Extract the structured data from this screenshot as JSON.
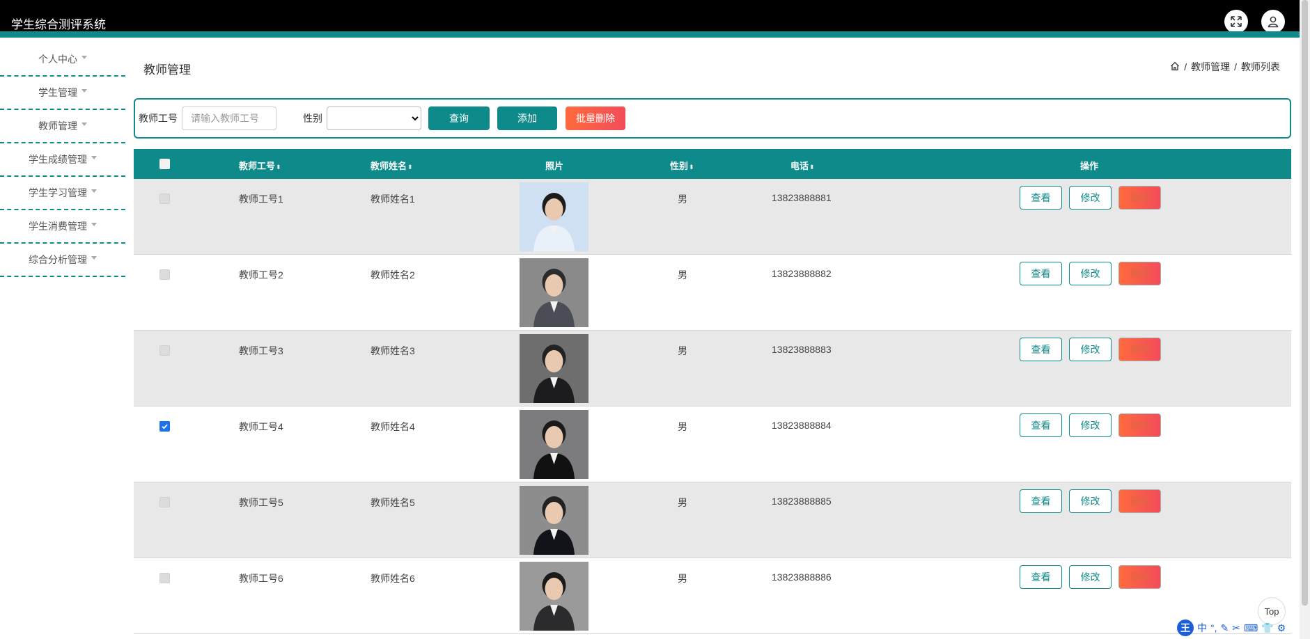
{
  "app": {
    "title": "学生综合测评系统"
  },
  "header_icons": [
    "fullscreen-icon",
    "user-icon"
  ],
  "sidebar": {
    "items": [
      {
        "label": "个人中心"
      },
      {
        "label": "学生管理"
      },
      {
        "label": "教师管理"
      },
      {
        "label": "学生成绩管理"
      },
      {
        "label": "学生学习管理"
      },
      {
        "label": "学生消费管理"
      },
      {
        "label": "综合分析管理"
      }
    ]
  },
  "page": {
    "title": "教师管理",
    "breadcrumb": [
      "教师管理",
      "教师列表"
    ]
  },
  "search": {
    "id_label": "教师工号",
    "id_placeholder": "请输入教师工号",
    "gender_label": "性别",
    "gender_value": "",
    "query_label": "查询",
    "add_label": "添加",
    "batch_delete_label": "批量删除"
  },
  "table": {
    "columns": [
      "教师工号",
      "教师姓名",
      "照片",
      "性别",
      "电话",
      "操作"
    ],
    "actions": {
      "view": "查看",
      "edit": "修改",
      "delete": "删除"
    },
    "rows": [
      {
        "id": "教师工号1",
        "name": "教师姓名1",
        "gender": "男",
        "phone": "13823888881",
        "checked": false,
        "photo_bg": "#cfe0f3",
        "suit": "#e8f0fa",
        "hair": "#1b1b1b"
      },
      {
        "id": "教师工号2",
        "name": "教师姓名2",
        "gender": "男",
        "phone": "13823888882",
        "checked": false,
        "photo_bg": "#8a8a8a",
        "suit": "#4a4d55",
        "hair": "#2b2b2b"
      },
      {
        "id": "教师工号3",
        "name": "教师姓名3",
        "gender": "男",
        "phone": "13823888883",
        "checked": false,
        "photo_bg": "#6e6e6e",
        "suit": "#1c1c1e",
        "hair": "#222"
      },
      {
        "id": "教师工号4",
        "name": "教师姓名4",
        "gender": "男",
        "phone": "13823888884",
        "checked": true,
        "photo_bg": "#7c7c7e",
        "suit": "#111",
        "hair": "#1a1a1a"
      },
      {
        "id": "教师工号5",
        "name": "教师姓名5",
        "gender": "男",
        "phone": "13823888885",
        "checked": false,
        "photo_bg": "#8d8d8d",
        "suit": "#111318",
        "hair": "#222"
      },
      {
        "id": "教师工号6",
        "name": "教师姓名6",
        "gender": "男",
        "phone": "13823888886",
        "checked": false,
        "photo_bg": "#9a9a9a",
        "suit": "#2b2b2e",
        "hair": "#1a1a1a"
      }
    ]
  },
  "misc": {
    "top_label": "Top",
    "ime_logo": "王",
    "ime_lang": "中"
  },
  "colors": {
    "accent": "#0e8a8a",
    "danger": "#f24c5a",
    "header_bg": "#000000"
  }
}
